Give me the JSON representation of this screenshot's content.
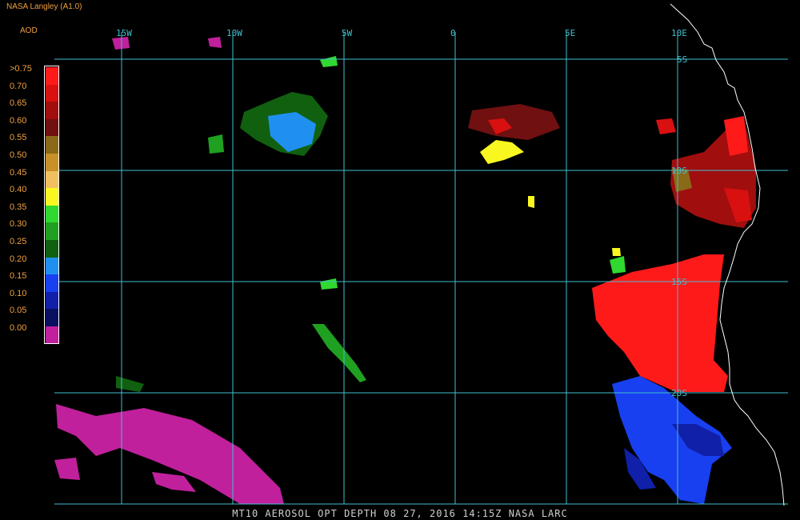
{
  "header": {
    "source": "NASA Langley (A1.0)",
    "product": "AOD"
  },
  "legend": {
    "title": "AOD",
    "items": [
      {
        "label": ">0.75",
        "color": "#ff1a1a"
      },
      {
        "label": "0.70",
        "color": "#d81010"
      },
      {
        "label": "0.65",
        "color": "#a00e0e"
      },
      {
        "label": "0.60",
        "color": "#701010"
      },
      {
        "label": "0.55",
        "color": "#8a6a18"
      },
      {
        "label": "0.50",
        "color": "#c89028"
      },
      {
        "label": "0.45",
        "color": "#f0c060"
      },
      {
        "label": "0.40",
        "color": "#f8f820"
      },
      {
        "label": "0.35",
        "color": "#30d830"
      },
      {
        "label": "0.30",
        "color": "#20a020"
      },
      {
        "label": "0.25",
        "color": "#106010"
      },
      {
        "label": "0.20",
        "color": "#2090f0"
      },
      {
        "label": "0.15",
        "color": "#1840f0"
      },
      {
        "label": "0.10",
        "color": "#1020a8"
      },
      {
        "label": "0.05",
        "color": "#0a1060"
      },
      {
        "label": "0.00",
        "color": "#c0209c"
      }
    ]
  },
  "map": {
    "grid_color": "#40c0d0",
    "coast_color": "#ffffff",
    "lon_labels": [
      "15W",
      "10W",
      "5W",
      "0",
      "5E",
      "10E"
    ],
    "lat_labels": [
      "5S",
      "10S",
      "15S",
      "20S"
    ]
  },
  "footer": {
    "caption": "MT10  AEROSOL OPT DEPTH   08 27, 2016 14:15Z   NASA LARC"
  }
}
